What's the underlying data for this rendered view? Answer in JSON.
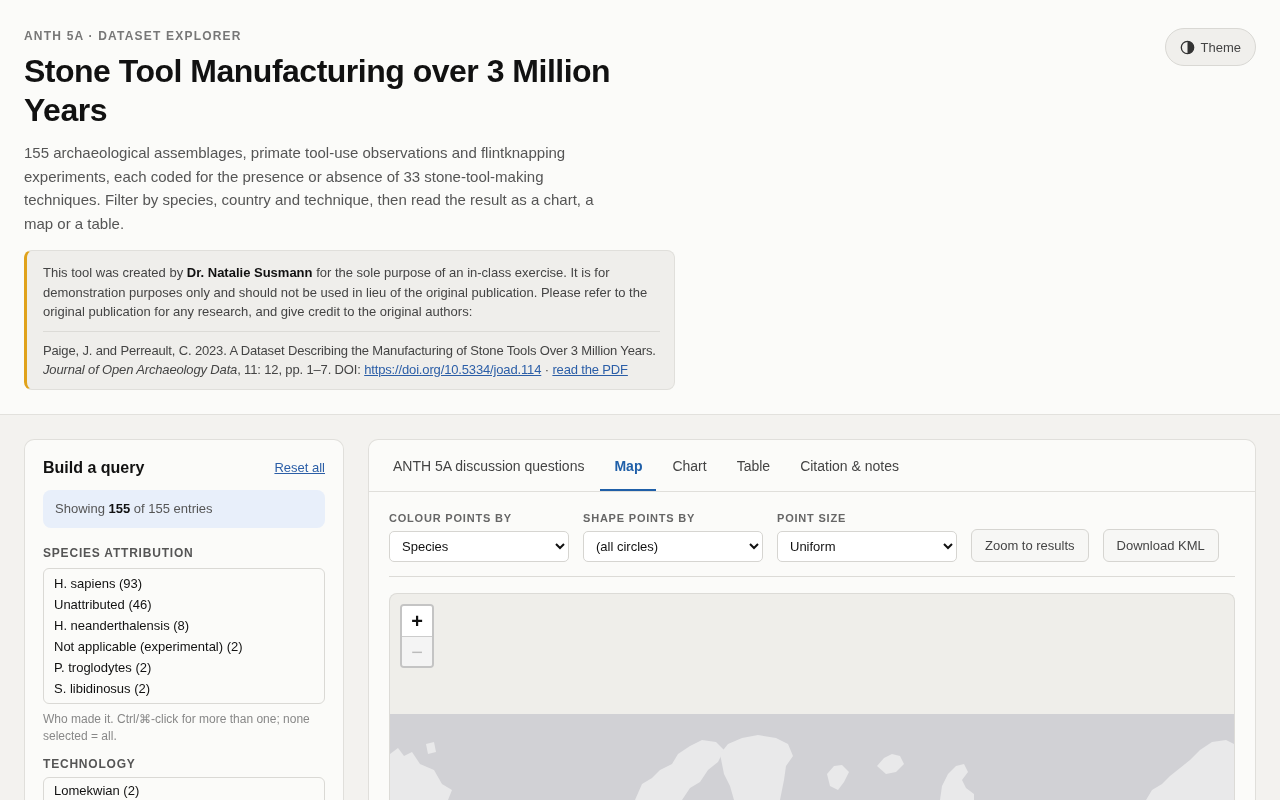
{
  "header": {
    "eyebrow": "ANTH 5A · DATASET EXPLORER",
    "title": "Stone Tool Manufacturing over 3 Million Years",
    "intro": "155 archaeological assemblages, primate tool-use observations and flintknapping experiments, each coded for the presence or absence of 33 stone-tool-making techniques. Filter by species, country and technique, then read the result as a chart, a map or a table.",
    "theme_button": "Theme"
  },
  "notice": {
    "text": "This tool was created by **Dr. Natalie Susmann** for the sole purpose of an in-class exercise. It is for demonstration purposes only and should not be used in lieu of the original publication. Please refer to the original publication for any research, and give credit to the original authors:",
    "citation": "Paige, J. and Perreault, C. 2023. A Dataset Describing the Manufacturing of Stone Tools Over 3 Million Years. *Journal of Open Archaeology Data*, 11: 12, pp. 1–7. DOI:",
    "links": [
      {
        "label": "https://doi.org/10.5334/joad.114"
      },
      {
        "label": "read the PDF"
      }
    ],
    "separator": "·"
  },
  "query": {
    "title": "Build a query",
    "reset": "Reset all",
    "summary": "Showing **155** of 155 entries",
    "filters": [
      {
        "label": "SPECIES ATTRIBUTION",
        "options": [
          {
            "label": "H. sapiens (93)",
            "selected": false
          },
          {
            "label": "Unattributed (46)",
            "selected": false
          },
          {
            "label": "H. neanderthalensis (8)",
            "selected": false
          },
          {
            "label": "Not applicable (experimental) (2)",
            "selected": false
          },
          {
            "label": "P. troglodytes (2)",
            "selected": false
          },
          {
            "label": "S. libidinosus (2)",
            "selected": false
          }
        ],
        "hint": "Who made it. Ctrl/⌘-click for more than one; none selected = all."
      },
      {
        "label": "TECHNOLOGY",
        "options": [
          {
            "label": "Lomekwian (2)",
            "selected": false
          }
        ]
      }
    ]
  },
  "results": {
    "tabs": [
      {
        "label": "ANTH 5A discussion questions",
        "selected": false
      },
      {
        "label": "Map",
        "selected": true
      },
      {
        "label": "Chart",
        "selected": false
      },
      {
        "label": "Table",
        "selected": false
      },
      {
        "label": "Citation & notes",
        "selected": false
      }
    ],
    "controls": [
      {
        "kind": "select",
        "label": "COLOUR POINTS BY",
        "value": "Species"
      },
      {
        "kind": "select",
        "label": "SHAPE POINTS BY",
        "value": "(all circles)"
      },
      {
        "kind": "select",
        "label": "POINT SIZE",
        "value": "Uniform"
      },
      {
        "kind": "button",
        "label": "Zoom to results"
      },
      {
        "kind": "button",
        "label": "Download KML"
      }
    ],
    "map": {
      "zoom_buttons": [
        {
          "label": "+",
          "disabled": false
        },
        {
          "label": "−",
          "disabled": true
        }
      ]
    }
  }
}
